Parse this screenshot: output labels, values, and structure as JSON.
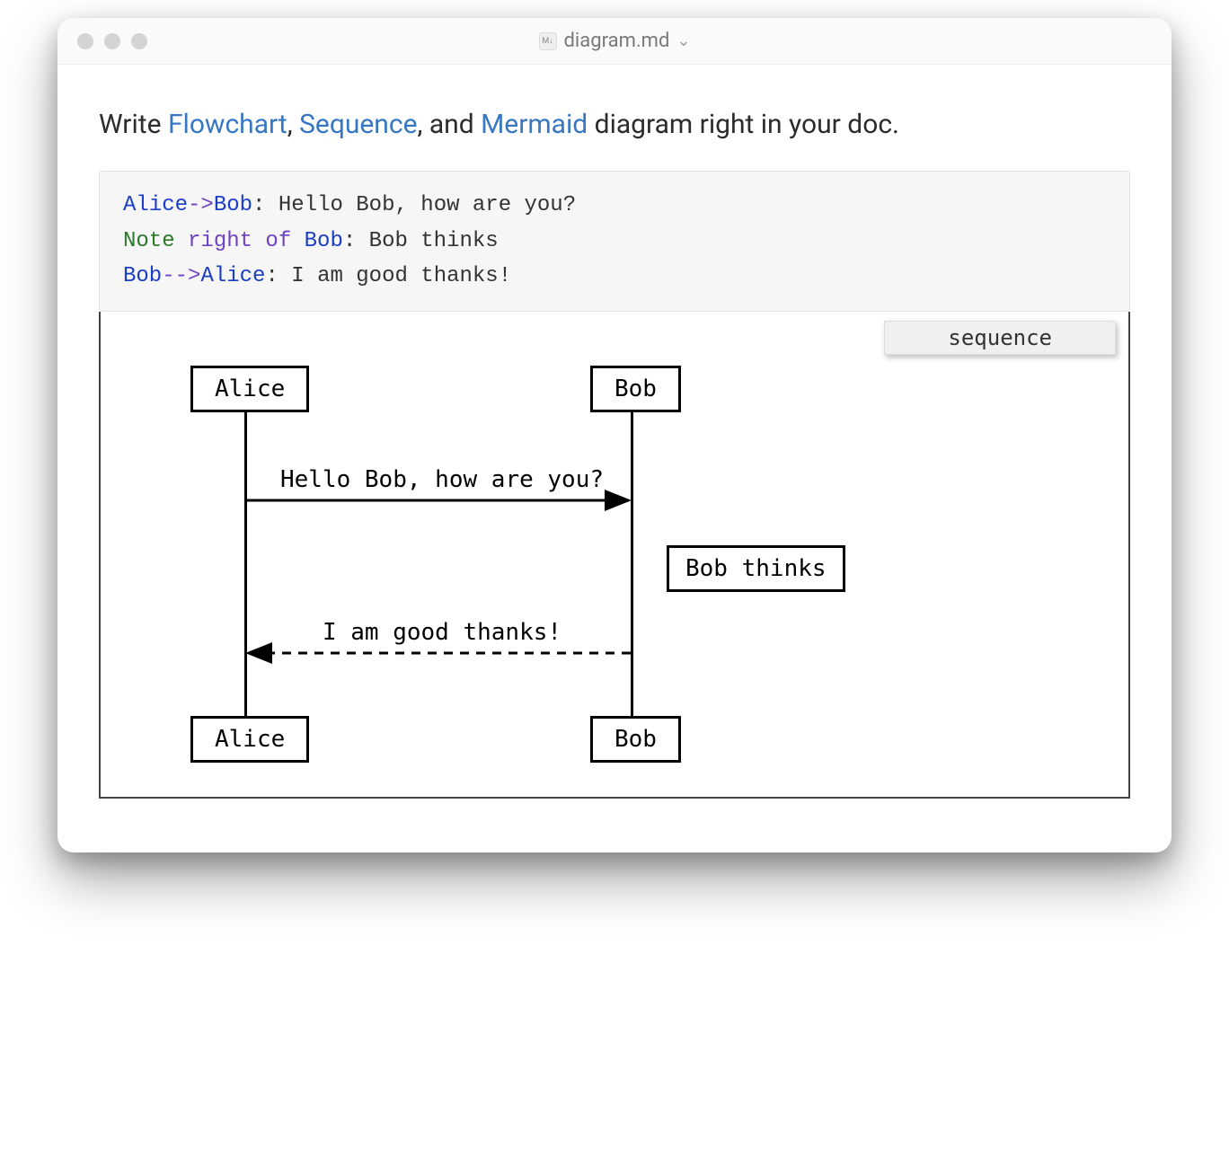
{
  "window": {
    "title": "diagram.md"
  },
  "intro": {
    "prefix": "Write ",
    "link1": "Flowchart",
    "sep1": ", ",
    "link2": "Sequence",
    "sep2": ", and ",
    "link3": "Mermaid",
    "suffix": " diagram right in your doc."
  },
  "code": {
    "l1_actor1": "Alice",
    "l1_arrow": "->",
    "l1_actor2": "Bob",
    "l1_colon": ": ",
    "l1_msg": "Hello Bob, how are you?",
    "l2_note": "Note",
    "l2_kw": " right of ",
    "l2_actor": "Bob",
    "l2_colon": ": ",
    "l2_msg": "Bob thinks",
    "l3_actor1": "Bob",
    "l3_arrow": "-->",
    "l3_actor2": "Alice",
    "l3_colon": ": ",
    "l3_msg": "I am good thanks!"
  },
  "diagram": {
    "type_label": "sequence",
    "actors": {
      "alice": "Alice",
      "bob": "Bob"
    },
    "messages": {
      "m1": "Hello Bob, how are you?",
      "m2": "I am good thanks!"
    },
    "note": "Bob thinks"
  }
}
